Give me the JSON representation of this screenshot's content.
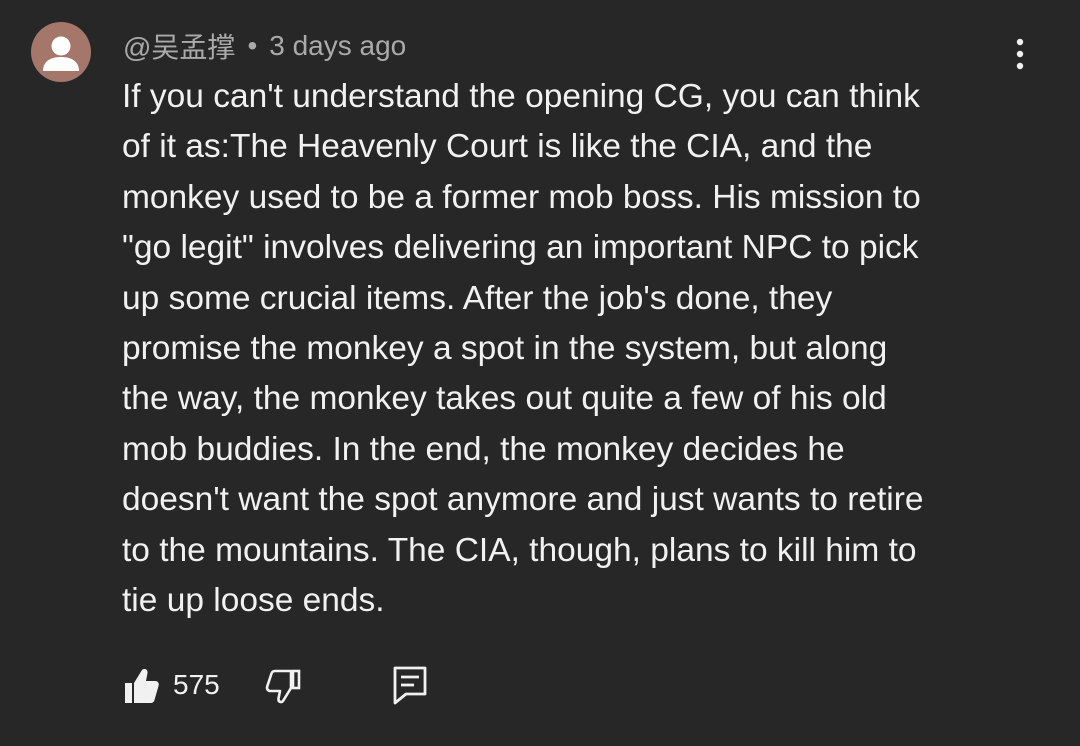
{
  "comment": {
    "author_handle": "@吴孟撑",
    "separator": "•",
    "timestamp": "3 days ago",
    "avatar_icon": "default-user-avatar",
    "avatar_color": "#a5776a",
    "text_lines": [
      "If you can't understand the opening CG, you can think",
      "of it as:The Heavenly Court is like the CIA, and the",
      "monkey used to be a former mob boss. His mission to",
      "\"go legit\" involves delivering an important NPC to pick",
      "up some crucial items. After the job's done, they",
      "promise the monkey a spot in the system, but along",
      "the way, the monkey takes out quite a few of his old",
      "mob buddies. In the end, the monkey decides he",
      "doesn't want the spot anymore and just wants to retire",
      "to the mountains. The CIA, though, plans to kill him to",
      "tie up loose ends."
    ],
    "like_count": "575",
    "icons": {
      "menu": "more-vertical-icon",
      "like": "thumbs-up-filled-icon",
      "dislike": "thumbs-down-outline-icon",
      "reply": "reply-comment-icon"
    }
  },
  "colors": {
    "background": "#272727",
    "text_primary": "#f1f1f1",
    "text_secondary": "#aaaaaa"
  }
}
